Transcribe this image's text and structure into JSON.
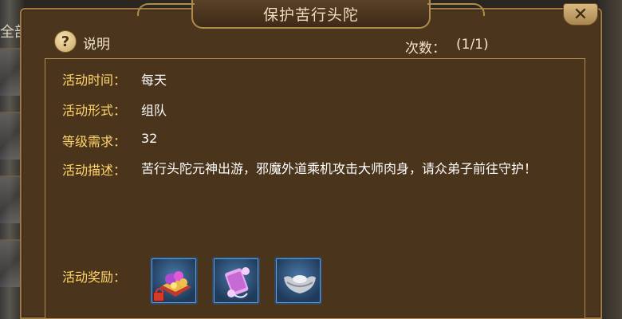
{
  "background": {
    "left_label": "全部"
  },
  "dialog": {
    "title": "保护苦行头陀",
    "close_symbol": "✕"
  },
  "help": {
    "icon_glyph": "?",
    "label": "说明"
  },
  "count": {
    "label": "次数：",
    "value": "(1/1)"
  },
  "details": {
    "time_label": "活动时间：",
    "time_value": "每天",
    "form_label": "活动形式：",
    "form_value": "组队",
    "level_label": "等级需求：",
    "level_value": "32",
    "desc_label": "活动描述：",
    "desc_value": "苦行头陀元神出游，邪魔外道乘机攻击大师肉身，请众弟子前往守护！",
    "reward_label": "活动奖励："
  },
  "rewards": [
    {
      "icon": "treasure-bundle-icon",
      "locked": true
    },
    {
      "icon": "scroll-icon",
      "locked": false
    },
    {
      "icon": "silver-ingot-icon",
      "locked": false
    }
  ],
  "colors": {
    "label": "#ffd66a",
    "value": "#ffffff",
    "panel": "#4b351d",
    "border": "#b08b4c"
  }
}
